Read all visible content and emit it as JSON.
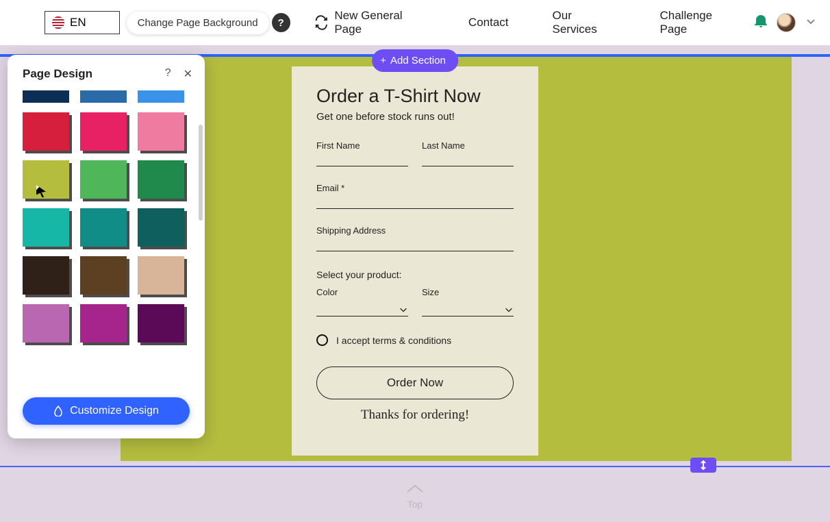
{
  "topbar": {
    "lang": "EN",
    "tooltip": "Change Page Background",
    "new_page": "New General Page",
    "nav": {
      "contact": "Contact",
      "services": "Our Services",
      "challenge": "Challenge Page"
    }
  },
  "add_section": "Add Section",
  "panel": {
    "title": "Page Design",
    "customize": "Customize Design",
    "swatches": [
      {
        "c": "#0b2e57",
        "h": true
      },
      {
        "c": "#2a6aa8",
        "h": true
      },
      {
        "c": "#3a93e8",
        "h": true
      },
      {
        "c": "#d61f3d"
      },
      {
        "c": "#e82064"
      },
      {
        "c": "#ef7ba0"
      },
      {
        "c": "#b4bd3e",
        "cur": true
      },
      {
        "c": "#4fb65a"
      },
      {
        "c": "#1f8a4c"
      },
      {
        "c": "#17b7a7"
      },
      {
        "c": "#0f8d86"
      },
      {
        "c": "#0f5f5e"
      },
      {
        "c": "#2f2117"
      },
      {
        "c": "#5d3f21"
      },
      {
        "c": "#d8b598"
      },
      {
        "c": "#b867b0"
      },
      {
        "c": "#a6258d"
      },
      {
        "c": "#5a0a57"
      }
    ]
  },
  "form": {
    "title": "Order a T-Shirt Now",
    "sub": "Get one before stock runs out!",
    "first": "First Name",
    "last": "Last Name",
    "email": "Email *",
    "ship": "Shipping Address",
    "select_hdr": "Select your product:",
    "color": "Color",
    "size": "Size",
    "terms": "I accept terms & conditions",
    "order": "Order Now",
    "thanks": "Thanks for ordering!"
  },
  "top_label": "Top"
}
